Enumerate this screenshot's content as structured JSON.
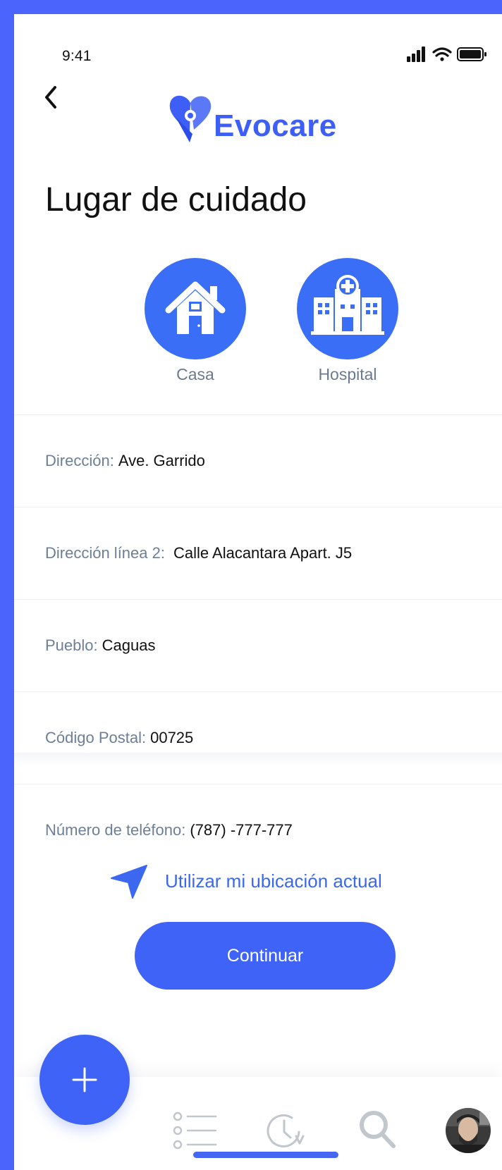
{
  "status_bar": {
    "time": "9:41"
  },
  "brand": {
    "name": "Evocare",
    "color": "#3d5ff5"
  },
  "page": {
    "title": "Lugar de cuidado"
  },
  "care_options": [
    {
      "label": "Casa",
      "icon": "house-icon"
    },
    {
      "label": "Hospital",
      "icon": "hospital-icon"
    }
  ],
  "form": {
    "address": {
      "label": "Dirección:",
      "value": "Ave. Garrido"
    },
    "address_line2": {
      "label": "Dirección línea 2:",
      "value": "Calle Alacantara Apart. J5"
    },
    "town": {
      "label": "Pueblo:",
      "value": "Caguas"
    },
    "postal_code": {
      "label": "Código Postal:",
      "value": "00725"
    },
    "phone": {
      "label": "Número de teléfono:",
      "value": "(787) -777-777"
    }
  },
  "actions": {
    "use_location": "Utilizar mi ubicación actual",
    "continue": "Continuar"
  },
  "colors": {
    "accent": "#3f63f6",
    "background_border": "#4b64fb",
    "label_gray": "#6d7f97"
  },
  "tabbar": {
    "items": [
      "list-icon",
      "history-icon",
      "search-icon",
      "profile-avatar"
    ]
  }
}
